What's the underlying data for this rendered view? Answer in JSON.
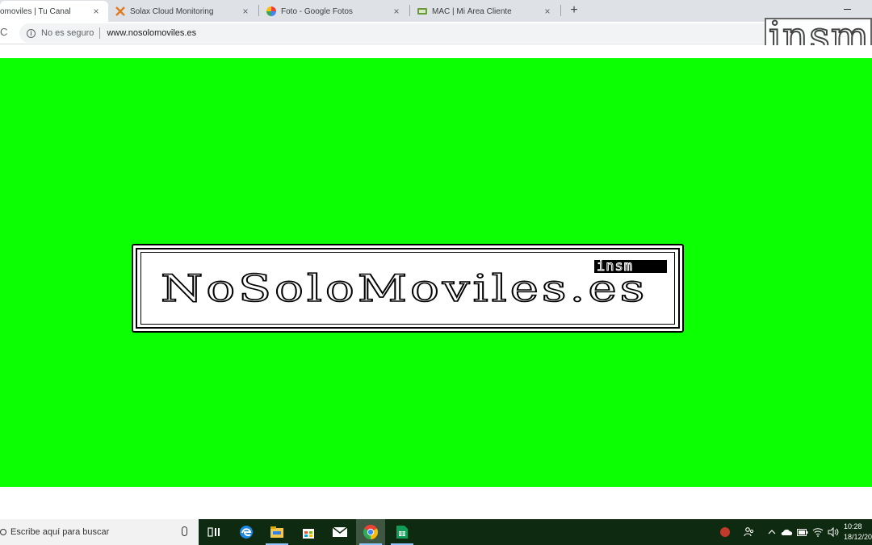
{
  "browser": {
    "tabs": [
      {
        "title": "omoviles | Tu Canal",
        "active": true
      },
      {
        "title": "Solax Cloud Monitoring",
        "active": false
      },
      {
        "title": "Foto - Google Fotos",
        "active": false
      },
      {
        "title": "MAC | Mi Área Cliente",
        "active": false
      }
    ],
    "new_tab_label": "+",
    "close_label": "×",
    "security_label": "No es seguro",
    "url": "www.nosolomoviles.es"
  },
  "watermark": {
    "text": "insm"
  },
  "page": {
    "background_color": "#0cff02",
    "logo_text": "NoSoloMoviles.es",
    "badge_text": "insm"
  },
  "taskbar": {
    "search_placeholder": "Escribe aquí para buscar",
    "apps": [
      "task-view-icon",
      "edge-icon",
      "file-explorer-icon",
      "store-icon",
      "mail-icon",
      "chrome-icon",
      "sheets-icon"
    ],
    "active_app": "chrome-icon",
    "time": "10:28",
    "date": "18/12/20"
  }
}
